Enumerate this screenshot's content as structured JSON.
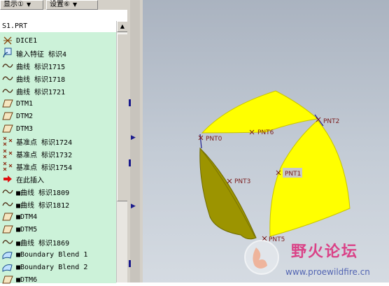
{
  "toolbar": {
    "display_label": "显示①",
    "settings_label": "设置⑥"
  },
  "tree": {
    "root": "S1.PRT",
    "items": [
      {
        "icon": "dice-icon",
        "label": "DICE1"
      },
      {
        "icon": "import-feature-icon",
        "label": "输入特征 标识4"
      },
      {
        "icon": "curve-icon",
        "label": "曲线 标识1715"
      },
      {
        "icon": "curve-icon",
        "label": "曲线 标识1718"
      },
      {
        "icon": "curve-icon",
        "label": "曲线 标识1721"
      },
      {
        "icon": "datum-plane-icon",
        "label": "DTM1"
      },
      {
        "icon": "datum-plane-icon",
        "label": "DTM2"
      },
      {
        "icon": "datum-plane-icon",
        "label": "DTM3"
      },
      {
        "icon": "datum-point-icon",
        "label": "基准点 标识1724"
      },
      {
        "icon": "datum-point-icon",
        "label": "基准点 标识1732"
      },
      {
        "icon": "datum-point-icon",
        "label": "基准点 标识1754"
      },
      {
        "icon": "insert-here-icon",
        "label": "在此插入"
      },
      {
        "icon": "curve-icon",
        "label": "■曲线 标识1809"
      },
      {
        "icon": "curve-icon",
        "label": "■曲线 标识1812"
      },
      {
        "icon": "datum-plane-icon",
        "label": "■DTM4"
      },
      {
        "icon": "datum-plane-icon",
        "label": "■DTM5"
      },
      {
        "icon": "curve-icon",
        "label": "■曲线 标识1869"
      },
      {
        "icon": "boundary-blend-icon",
        "label": "■Boundary Blend 1"
      },
      {
        "icon": "boundary-blend-icon",
        "label": "■Boundary Blend 2"
      },
      {
        "icon": "datum-plane-icon",
        "label": "■DTM6"
      }
    ]
  },
  "viewport": {
    "points": [
      "PNT0",
      "PNT1",
      "PNT2",
      "PNT3",
      "PNT5",
      "PNT6"
    ],
    "surface_color": "#ffff00",
    "shaded_surface_color": "#9c9400",
    "background_color": "#c4ccd6"
  },
  "watermark": {
    "title": "野火论坛",
    "url": "www.proewildfire.cn"
  }
}
